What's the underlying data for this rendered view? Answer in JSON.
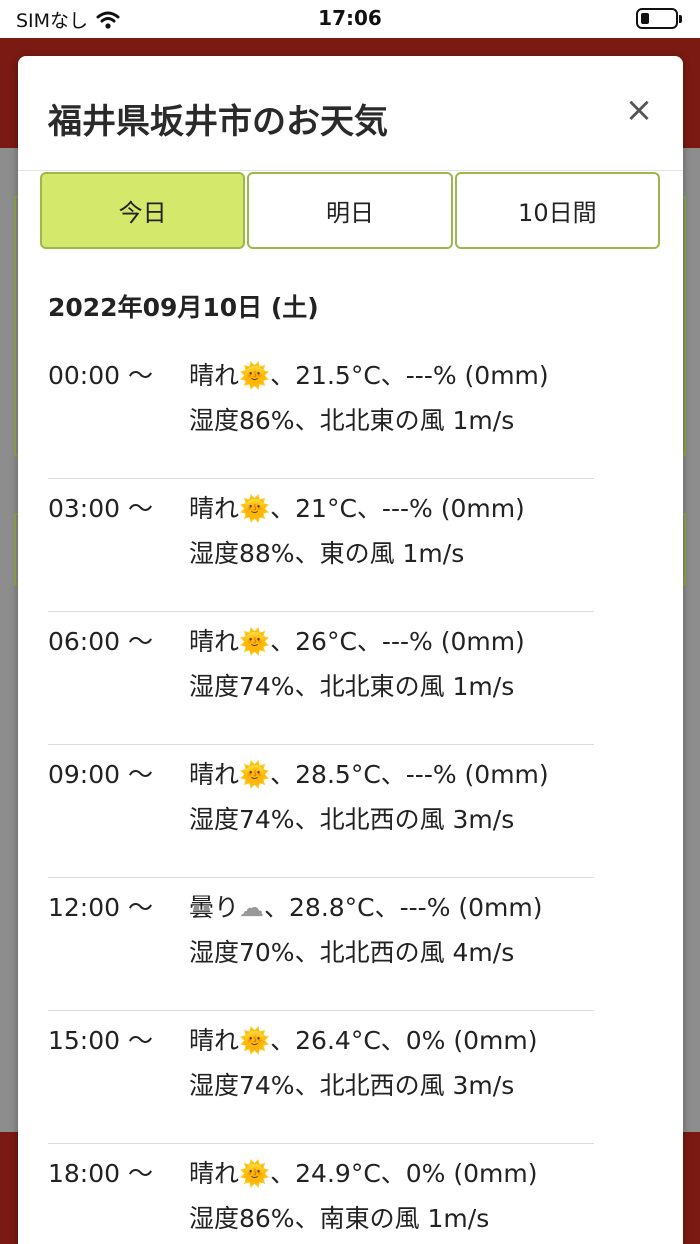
{
  "status_bar": {
    "carrier": "SIMなし",
    "time": "17:06"
  },
  "modal": {
    "title": "福井県坂井市のお天気",
    "close_label": "×",
    "tabs": [
      {
        "label": "今日",
        "active": true
      },
      {
        "label": "明日",
        "active": false
      },
      {
        "label": "10日間",
        "active": false
      }
    ],
    "date": "2022年09月10日 (土)",
    "rows": [
      {
        "time": "00:00 〜",
        "weather": "晴れ",
        "icon": "sun-icon",
        "details": "、21.5°C、---% (0mm)",
        "line2": "湿度86%、北北東の風 1m/s"
      },
      {
        "time": "03:00 〜",
        "weather": "晴れ",
        "icon": "sun-icon",
        "details": "、21°C、---% (0mm)",
        "line2": "湿度88%、東の風 1m/s"
      },
      {
        "time": "06:00 〜",
        "weather": "晴れ",
        "icon": "sun-icon",
        "details": "、26°C、---% (0mm)",
        "line2": "湿度74%、北北東の風 1m/s"
      },
      {
        "time": "09:00 〜",
        "weather": "晴れ",
        "icon": "sun-icon",
        "details": "、28.5°C、---% (0mm)",
        "line2": "湿度74%、北北西の風 3m/s"
      },
      {
        "time": "12:00 〜",
        "weather": "曇り",
        "icon": "cloud-icon",
        "details": "、28.8°C、---% (0mm)",
        "line2": "湿度70%、北北西の風 4m/s"
      },
      {
        "time": "15:00 〜",
        "weather": "晴れ",
        "icon": "sun-icon",
        "details": "、26.4°C、0% (0mm)",
        "line2": "湿度74%、北北西の風 3m/s"
      },
      {
        "time": "18:00 〜",
        "weather": "晴れ",
        "icon": "sun-icon",
        "details": "、24.9°C、0% (0mm)",
        "line2": "湿度86%、南東の風 1m/s"
      }
    ]
  },
  "colors": {
    "tab_active": "#d4e86b",
    "tab_border": "#9bb84c",
    "app_header": "#7a1a12"
  }
}
